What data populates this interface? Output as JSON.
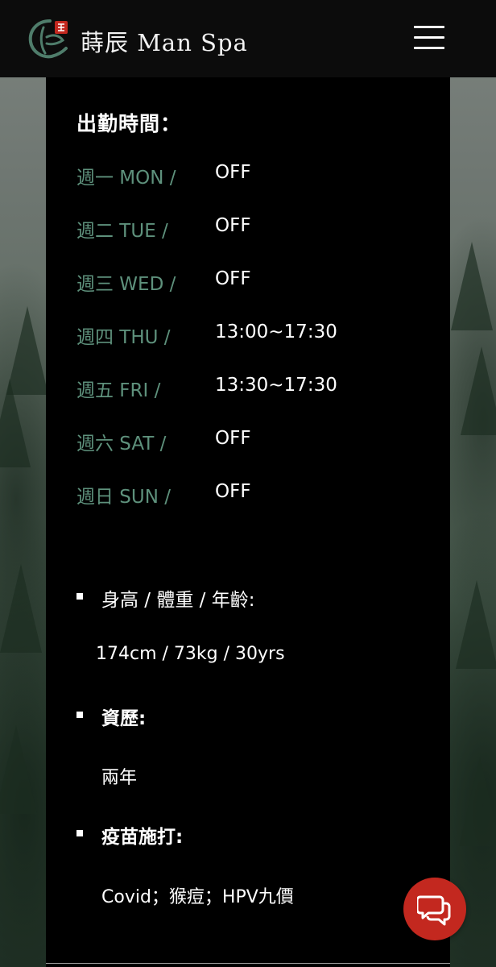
{
  "header": {
    "brand": "蒔辰 Man Spa",
    "logo_icon": "brand-logo-icon",
    "menu_icon": "hamburger-menu-icon"
  },
  "schedule": {
    "title": "出勤時間：",
    "days": [
      {
        "day": "週一 MON /",
        "hours": "OFF"
      },
      {
        "day": "週二 TUE /",
        "hours": "OFF"
      },
      {
        "day": "週三 WED /",
        "hours": "OFF"
      },
      {
        "day": "週四 THU /",
        "hours": "13:00~17:30"
      },
      {
        "day": "週五 FRI /",
        "hours": "13:30~17:30"
      },
      {
        "day": "週六 SAT /",
        "hours": "OFF"
      },
      {
        "day": "週日 SUN /",
        "hours": "OFF"
      }
    ]
  },
  "profile": {
    "stats_label": "身高 / 體重 / 年齡:",
    "stats_value": "174cm / 73kg / 30yrs",
    "experience_label": "資歷:",
    "experience_value": "兩年",
    "vaccine_label": "疫苗施打:",
    "vaccine_value": "Covid；猴痘；HPV九價"
  },
  "chat": {
    "icon": "chat-bubbles-icon"
  },
  "colors": {
    "day_label": "#5e917c",
    "chat_button": "#c3281f",
    "panel": "#000000",
    "header": "#0c0c0c"
  }
}
